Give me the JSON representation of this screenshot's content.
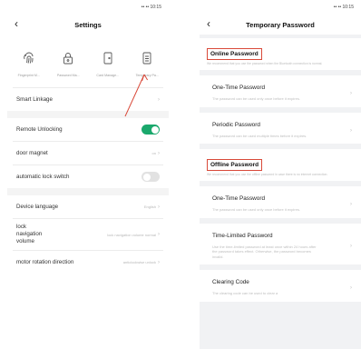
{
  "left": {
    "status_text": "•• •• 10:15",
    "title": "Settings",
    "back_icon": "chevron-left-icon",
    "feature_icons": [
      {
        "icon": "fingerprint-icon",
        "label": "Fingerprint M..."
      },
      {
        "icon": "password-lock-icon",
        "label": "Password Ma..."
      },
      {
        "icon": "card-icon",
        "label": "Card Manage..."
      },
      {
        "icon": "temporary-password-icon",
        "label": "Temporary Pa..."
      }
    ],
    "rows": [
      {
        "label": "Smart Linkage",
        "value": ""
      },
      {
        "label": "Remote Unlocking",
        "toggle": "on"
      },
      {
        "label": "door magnet",
        "value": "on"
      },
      {
        "label": "automatic lock switch",
        "toggle": "off"
      },
      {
        "label": "Device language",
        "value": "English"
      },
      {
        "label": "lock navigation volume",
        "value": "lock navigation volume normal"
      },
      {
        "label": "motor rotation direction",
        "value": "anticlockwise unlock"
      }
    ],
    "annotation_color": "#d94a3a",
    "toggle_on_color": "#1aa86c"
  },
  "right": {
    "status_text": "•• •• 10:15",
    "title": "Temporary Password",
    "online": {
      "title": "Online Password",
      "desc": "We recommend that you use the password when the Bluetooth connection is normal.",
      "items": [
        {
          "title": "One-Time Password",
          "desc": "The password can be used only once before it expires."
        },
        {
          "title": "Periodic Password",
          "desc": "The password can be used multiple times before it expires."
        }
      ]
    },
    "offline": {
      "title": "Offline Password",
      "desc": "We recommend that you use the offline password in case there is no internet connection.",
      "items": [
        {
          "title": "One-Time Password",
          "desc": "The password can be used only once before it expires."
        },
        {
          "title": "Time-Limited Password",
          "desc": "Use the time-limited password at least once within 24 hours after the password takes effect. Otherwise, the password becomes invalid."
        },
        {
          "title": "Clearing Code",
          "desc": "The clearing code can be used to clear a"
        }
      ]
    },
    "highlight_color": "#d94a3a"
  }
}
